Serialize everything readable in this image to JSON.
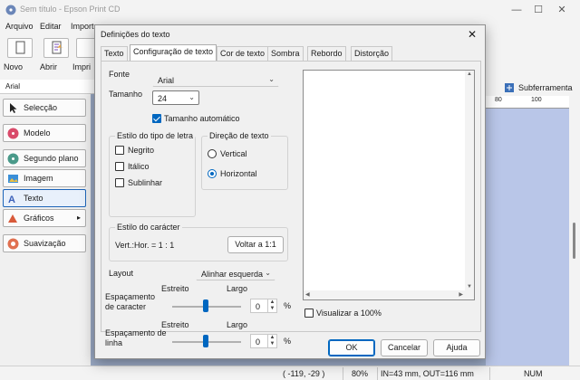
{
  "app": {
    "title": "Sem título - Epson Print CD",
    "window_controls": {
      "minimize": "—",
      "maximize": "☐",
      "close": "✕"
    },
    "menu": [
      "Arquivo",
      "Editar",
      "Import"
    ],
    "toolbar": [
      {
        "label": "Novo",
        "icon": "new-document-icon"
      },
      {
        "label": "Abrir",
        "icon": "open-file-icon"
      },
      {
        "label": "Impri",
        "icon": "print-icon"
      }
    ],
    "font_field": "Arial",
    "sidebar": [
      {
        "label": "Selecção",
        "icon": "cursor-arrow-icon"
      },
      {
        "label": "Modelo",
        "icon": "template-icon"
      },
      {
        "label": "Segundo plano",
        "icon": "background-icon"
      },
      {
        "label": "Imagem",
        "icon": "image-icon"
      },
      {
        "label": "Texto",
        "icon": "text-icon",
        "active": true
      },
      {
        "label": "Gráficos",
        "icon": "graphics-icon",
        "submenu": true
      },
      {
        "label": "Suavização",
        "icon": "smoothing-icon"
      }
    ],
    "right_tool": "Subferramenta",
    "ruler": {
      "marks": [
        "80",
        "100"
      ]
    },
    "status": {
      "coords": "( -119, -29 )",
      "zoom": "80%",
      "diam": "IN=43 mm, OUT=116 mm",
      "num": "NUM"
    }
  },
  "dialog": {
    "title": "Definições do texto",
    "close": "✕",
    "tabs": [
      "Texto",
      "Configuração de texto",
      "Cor de texto",
      "Sombra",
      "Rebordo",
      "Distorção"
    ],
    "active_tab": 1,
    "font_label": "Fonte",
    "font_value": "Arial",
    "size_label": "Tamanho",
    "size_value": "24",
    "auto_size": {
      "label": "Tamanho automático",
      "checked": true
    },
    "style_group": {
      "title": "Estilo do tipo de letra",
      "options": [
        {
          "label": "Negrito",
          "checked": false
        },
        {
          "label": "Itálico",
          "checked": false
        },
        {
          "label": "Sublinhar",
          "checked": false
        }
      ]
    },
    "direction_group": {
      "title": "Direção de texto",
      "options": [
        {
          "label": "Vertical",
          "selected": false
        },
        {
          "label": "Horizontal",
          "selected": true
        }
      ]
    },
    "char_style_group": {
      "title": "Estilo do carácter",
      "ratio": "Vert.:Hor. = 1 : 1",
      "reset_button": "Voltar a 1:1"
    },
    "layout_label": "Layout",
    "layout_value": "Alinhar esquerda",
    "char_spacing": {
      "label": "Espaçamento de caracter",
      "narrow": "Estreito",
      "wide": "Largo",
      "value": "0",
      "unit": "%"
    },
    "line_spacing": {
      "label": "Espaçamento de linha",
      "narrow": "Estreito",
      "wide": "Largo",
      "value": "0",
      "unit": "%"
    },
    "preview_100": {
      "label": "Visualizar a 100%",
      "checked": false
    },
    "buttons": {
      "ok": "OK",
      "cancel": "Cancelar",
      "help": "Ajuda"
    }
  },
  "colors": {
    "accent": "#0067c0",
    "canvas": "#9aa9c4",
    "page": "#b9c6e8"
  }
}
